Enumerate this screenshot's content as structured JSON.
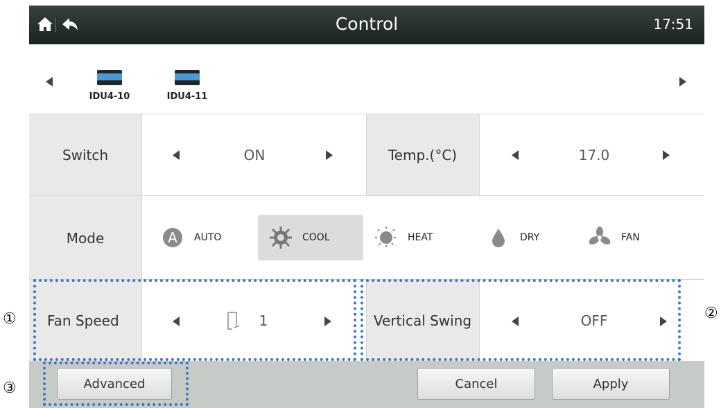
{
  "header": {
    "title": "Control",
    "time": "17:51",
    "home_icon": "home-icon",
    "back_icon": "back-icon"
  },
  "devices": [
    {
      "name": "IDU4-10"
    },
    {
      "name": "IDU4-11"
    }
  ],
  "switch": {
    "label": "Switch",
    "value": "ON"
  },
  "temp": {
    "label": "Temp.(°C)",
    "value": "17.0"
  },
  "mode": {
    "label": "Mode",
    "options": [
      {
        "label": "AUTO",
        "icon": "auto-icon"
      },
      {
        "label": "COOL",
        "icon": "snowflake-icon"
      },
      {
        "label": "HEAT",
        "icon": "sun-icon"
      },
      {
        "label": "DRY",
        "icon": "droplet-icon"
      },
      {
        "label": "FAN",
        "icon": "fan-icon"
      }
    ],
    "selected": "COOL"
  },
  "fan_speed": {
    "label": "Fan Speed",
    "value": "1"
  },
  "vertical_swing": {
    "label": "Vertical Swing",
    "value": "OFF"
  },
  "footer": {
    "advanced_label": "Advanced",
    "cancel_label": "Cancel",
    "apply_label": "Apply"
  },
  "callouts": [
    "①",
    "②",
    "③"
  ],
  "colors": {
    "header_bg": "#2b3332",
    "highlight": "#3d78c4",
    "footer_bg": "#c6cbc7",
    "device_accent": "#4b99d8"
  }
}
